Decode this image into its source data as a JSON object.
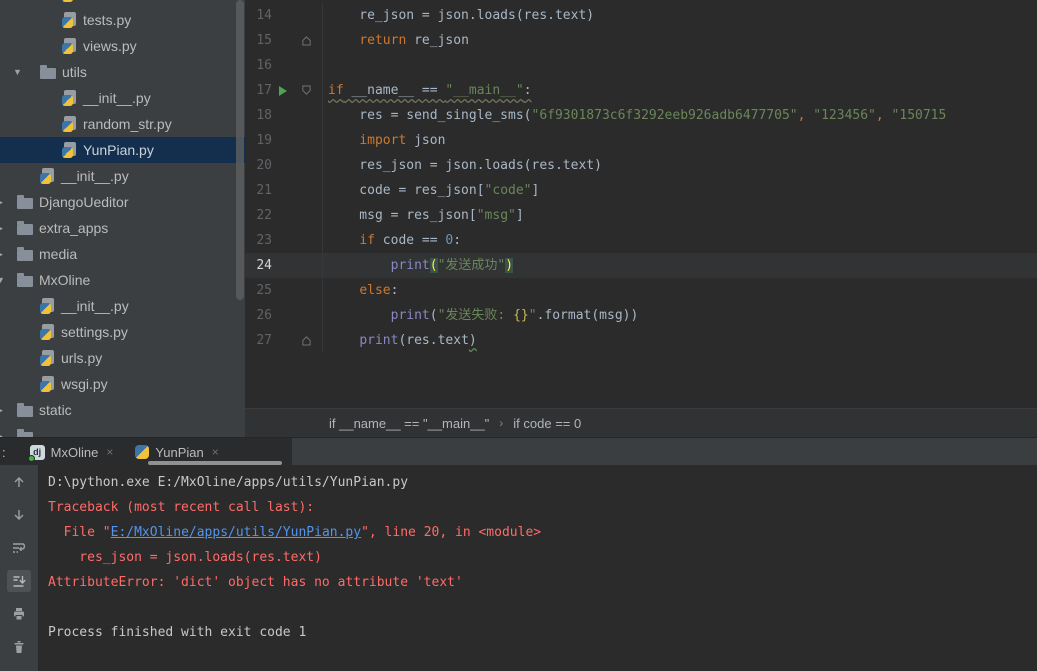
{
  "colors": {
    "editor_bg": "#2b2b2b",
    "panel_bg": "#3c3f41",
    "selection_bg": "#132f4d",
    "keyword": "#cc7832",
    "string": "#6a8759",
    "number": "#6897bb",
    "builtin": "#8a87c5",
    "error_red": "#ff6b68",
    "link_blue": "#5394ec",
    "run_green": "#4da54f",
    "current_line_bg": "#323334",
    "tab_underline": "#8f9294"
  },
  "sidebar": {
    "items": [
      {
        "label": "",
        "kind": "py",
        "level": 3,
        "selected": false,
        "arrow": null
      },
      {
        "label": "tests.py",
        "kind": "py",
        "level": 3,
        "selected": false,
        "arrow": null
      },
      {
        "label": "views.py",
        "kind": "py",
        "level": 3,
        "selected": false,
        "arrow": null
      },
      {
        "label": "utils",
        "kind": "folder",
        "level": 2,
        "selected": false,
        "arrow": "down"
      },
      {
        "label": "__init__.py",
        "kind": "py",
        "level": 3,
        "selected": false,
        "arrow": null
      },
      {
        "label": "random_str.py",
        "kind": "py",
        "level": 3,
        "selected": false,
        "arrow": null
      },
      {
        "label": "YunPian.py",
        "kind": "py",
        "level": 3,
        "selected": true,
        "arrow": null
      },
      {
        "label": "__init__.py",
        "kind": "py",
        "level": 2,
        "selected": false,
        "arrow": null
      },
      {
        "label": "DjangoUeditor",
        "kind": "folder",
        "level": 1,
        "selected": false,
        "arrow": "right-edge"
      },
      {
        "label": "extra_apps",
        "kind": "folder",
        "level": 1,
        "selected": false,
        "arrow": "right-edge"
      },
      {
        "label": "media",
        "kind": "folder",
        "level": 1,
        "selected": false,
        "arrow": "right-edge"
      },
      {
        "label": "MxOline",
        "kind": "folder",
        "level": 1,
        "selected": false,
        "arrow": "down-edge"
      },
      {
        "label": "__init__.py",
        "kind": "py",
        "level": 2,
        "selected": false,
        "arrow": null
      },
      {
        "label": "settings.py",
        "kind": "py",
        "level": 2,
        "selected": false,
        "arrow": null
      },
      {
        "label": "urls.py",
        "kind": "py",
        "level": 2,
        "selected": false,
        "arrow": null
      },
      {
        "label": "wsgi.py",
        "kind": "py",
        "level": 2,
        "selected": false,
        "arrow": null
      },
      {
        "label": "static",
        "kind": "folder",
        "level": 1,
        "selected": false,
        "arrow": "right-edge"
      },
      {
        "label": "",
        "kind": "folder",
        "level": 1,
        "selected": false,
        "arrow": "right-edge"
      }
    ]
  },
  "editor": {
    "lines": [
      {
        "num": "14",
        "fold": null,
        "run": false,
        "current": false,
        "wavy": false,
        "tokens": [
          [
            "    re_json = json.loads(res.text)",
            "p"
          ]
        ]
      },
      {
        "num": "15",
        "fold": "up",
        "run": false,
        "current": false,
        "wavy": false,
        "tokens": [
          [
            "    ",
            "p"
          ],
          [
            "return",
            "k"
          ],
          [
            " re_json",
            "p"
          ]
        ]
      },
      {
        "num": "16",
        "fold": null,
        "run": false,
        "current": false,
        "wavy": false,
        "tokens": []
      },
      {
        "num": "17",
        "fold": "down",
        "run": true,
        "current": false,
        "wavy": true,
        "tokens": [
          [
            "if",
            "k"
          ],
          [
            " __name__ == ",
            "p"
          ],
          [
            "\"__main__\"",
            "s"
          ],
          [
            ":",
            "p"
          ]
        ]
      },
      {
        "num": "18",
        "fold": null,
        "run": false,
        "current": false,
        "wavy": false,
        "tokens": [
          [
            "    res = send_single_sms(",
            "p"
          ],
          [
            "\"6f9301873c6f3292eeb926adb6477705\"",
            "s"
          ],
          [
            ",",
            "c"
          ],
          [
            " ",
            "p"
          ],
          [
            "\"123456\"",
            "s"
          ],
          [
            ",",
            "c"
          ],
          [
            " ",
            "p"
          ],
          [
            "\"150715",
            "s"
          ]
        ]
      },
      {
        "num": "19",
        "fold": null,
        "run": false,
        "current": false,
        "wavy": false,
        "tokens": [
          [
            "    ",
            "p"
          ],
          [
            "import",
            "k"
          ],
          [
            " json",
            "p"
          ]
        ]
      },
      {
        "num": "20",
        "fold": null,
        "run": false,
        "current": false,
        "wavy": false,
        "tokens": [
          [
            "    res_json = json.loads(res.text)",
            "p"
          ]
        ]
      },
      {
        "num": "21",
        "fold": null,
        "run": false,
        "current": false,
        "wavy": false,
        "tokens": [
          [
            "    code = res_json[",
            "p"
          ],
          [
            "\"code\"",
            "s"
          ],
          [
            "]",
            "p"
          ]
        ]
      },
      {
        "num": "22",
        "fold": null,
        "run": false,
        "current": false,
        "wavy": false,
        "tokens": [
          [
            "    msg = res_json[",
            "p"
          ],
          [
            "\"msg\"",
            "s"
          ],
          [
            "]",
            "p"
          ]
        ]
      },
      {
        "num": "23",
        "fold": null,
        "run": false,
        "current": false,
        "wavy": false,
        "tokens": [
          [
            "    ",
            "p"
          ],
          [
            "if",
            "k"
          ],
          [
            " code == ",
            "p"
          ],
          [
            "0",
            "n"
          ],
          [
            ":",
            "p"
          ]
        ]
      },
      {
        "num": "24",
        "fold": null,
        "run": false,
        "current": true,
        "wavy": false,
        "tokens": [
          [
            "        ",
            "p"
          ],
          [
            "print",
            "b"
          ],
          [
            "(",
            "hl"
          ],
          [
            "\"发送成功\"",
            "s"
          ],
          [
            ")",
            "hl"
          ]
        ]
      },
      {
        "num": "25",
        "fold": null,
        "run": false,
        "current": false,
        "wavy": false,
        "tokens": [
          [
            "    ",
            "p"
          ],
          [
            "else",
            "k"
          ],
          [
            ":",
            "p"
          ]
        ]
      },
      {
        "num": "26",
        "fold": null,
        "run": false,
        "current": false,
        "wavy": false,
        "tokens": [
          [
            "        ",
            "p"
          ],
          [
            "print",
            "b"
          ],
          [
            "(",
            "p"
          ],
          [
            "\"发送失败: ",
            "s"
          ],
          [
            "{}",
            "fmt"
          ],
          [
            "\"",
            "s"
          ],
          [
            ".format(msg))",
            "p"
          ]
        ]
      },
      {
        "num": "27",
        "fold": "up",
        "run": false,
        "current": false,
        "wavy": false,
        "tokens": [
          [
            "    ",
            "p"
          ],
          [
            "print",
            "b"
          ],
          [
            "(res.text",
            "p"
          ],
          [
            ")",
            "psq"
          ]
        ]
      }
    ]
  },
  "breadcrumbs": {
    "separator": "›",
    "items": [
      "if __name__ == \"__main__\"",
      "if code == 0"
    ]
  },
  "run_panel": {
    "header_prefix": ":",
    "tabs": [
      {
        "label": "MxOline",
        "icon": "django-icon",
        "icon_text": "dj",
        "close": "×",
        "selected": false,
        "running": true
      },
      {
        "label": "YunPian",
        "icon": "python-icon",
        "close": "×",
        "selected": true,
        "running": false
      }
    ],
    "toolbar": [
      {
        "name": "up-stacktrace"
      },
      {
        "name": "down-stacktrace"
      },
      {
        "name": "soft-wrap"
      },
      {
        "name": "scroll-to-end",
        "selected": true
      },
      {
        "name": "print"
      },
      {
        "name": "clear-all"
      }
    ],
    "console_lines": [
      {
        "segments": [
          [
            "D:\\python.exe E:/MxOline/apps/utils/YunPian.py",
            "out"
          ]
        ]
      },
      {
        "segments": [
          [
            "Traceback (most recent call last):",
            "err"
          ]
        ]
      },
      {
        "segments": [
          [
            "  File \"",
            "err"
          ],
          [
            "E:/MxOline/apps/utils/YunPian.py",
            "link"
          ],
          [
            "\", line 20, in <module>",
            "err"
          ]
        ]
      },
      {
        "segments": [
          [
            "    res_json = json.loads(res.text)",
            "err"
          ]
        ]
      },
      {
        "segments": [
          [
            "AttributeError: 'dict' object has no attribute 'text'",
            "err"
          ]
        ]
      },
      {
        "segments": []
      },
      {
        "segments": [
          [
            "Process finished with exit code 1",
            "out"
          ]
        ]
      }
    ]
  }
}
